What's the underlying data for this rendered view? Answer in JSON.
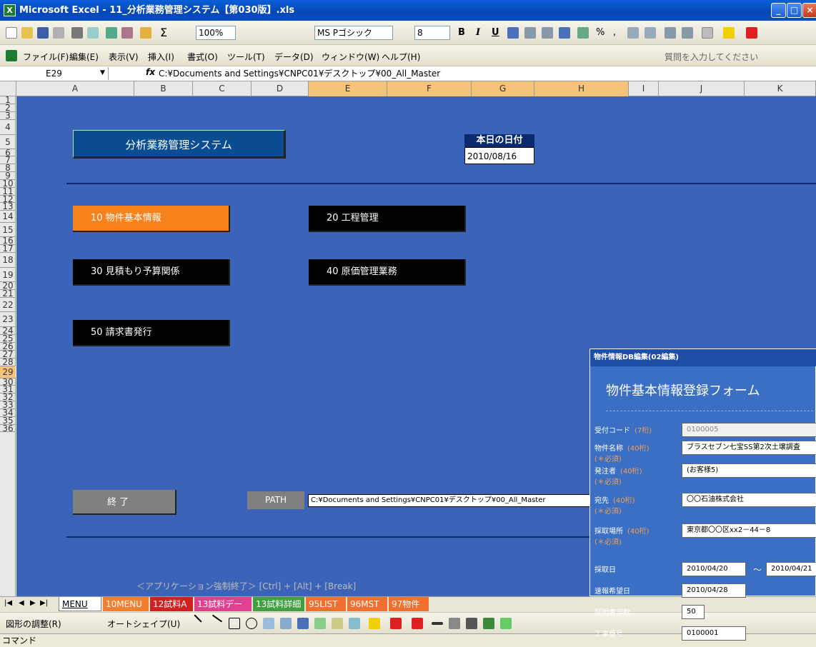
{
  "window": {
    "title": "Microsoft Excel - 11_分析業務管理システム【第030版】.xls",
    "excel_badge": "X"
  },
  "toolbar": {
    "zoom": "100%",
    "font": "MS Pゴシック",
    "size": "8",
    "bold": "B",
    "italic": "I",
    "underline": "U",
    "percent": "%",
    "comma": ","
  },
  "menu": {
    "items": [
      "ファイル(F)",
      "編集(E)",
      "表示(V)",
      "挿入(I)",
      "書式(O)",
      "ツール(T)",
      "データ(D)",
      "ウィンドウ(W)",
      "ヘルプ(H)"
    ],
    "help_placeholder": "質問を入力してください"
  },
  "formula_bar": {
    "cell": "E29",
    "fx": "fx",
    "value": "C:¥Documents and Settings¥CNPC01¥デスクトップ¥00_All_Master"
  },
  "columns": [
    "A",
    "B",
    "C",
    "D",
    "E",
    "F",
    "G",
    "H",
    "I",
    "J",
    "K"
  ],
  "rows": [
    "1",
    "2",
    "3",
    "4",
    "5",
    "6",
    "7",
    "8",
    "9",
    "10",
    "11",
    "12",
    "13",
    "14",
    "15",
    "16",
    "17",
    "18",
    "19",
    "20",
    "21",
    "22",
    "23",
    "24",
    "25",
    "26",
    "27",
    "28",
    "29",
    "30",
    "31",
    "32",
    "33",
    "34",
    "35",
    "36"
  ],
  "sheet": {
    "app_title": "分析業務管理システム",
    "date_label": "本日の日付",
    "date_value": "2010/08/16",
    "buttons": [
      "10 物件基本情報",
      "20 工程管理",
      "30 見積もり予算関係",
      "40 原価管理業務",
      "50 請求書発行"
    ],
    "exit_label": "終 了",
    "path_label": "PATH",
    "path_value": "C:¥Documents and Settings¥CNPC01¥デスクトップ¥00_All_Master",
    "footer_note": "＜アプリケーション強制終了＞ [Ctrl] + [Alt] + [Break]"
  },
  "tabs": [
    "MENU",
    "10MENU",
    "12試料A",
    "13試料データ",
    "13試料詳細",
    "95LIST",
    "96MST",
    "97物件"
  ],
  "tab_colors": [
    "#ffffff",
    "#f08030",
    "#d02020",
    "#e04090",
    "#40a040",
    "#f07030",
    "#f07030",
    "#f07030"
  ],
  "draw_toolbar": {
    "adjust": "図形の調整(R)",
    "autoshape": "オートシェイプ(U)"
  },
  "status": "コマンド",
  "form": {
    "window_title": "物件情報DB編集(02編集)",
    "heading": "物件基本情報登録フォーム",
    "fields": [
      {
        "label": "受付コード",
        "hint": "(7桁)",
        "req": "",
        "value": "0100005"
      },
      {
        "label": "物件名称",
        "hint": "(40桁)",
        "req": "(＊必須)",
        "value": "ブラスセブン七宝SS第2次土壌調査"
      },
      {
        "label": "発注者",
        "hint": "(40桁)",
        "req": "(＊必須)",
        "value": "(お客様5)"
      },
      {
        "label": "宛先",
        "hint": "(40桁)",
        "req": "(＊必須)",
        "value": "〇〇石油株式会社"
      },
      {
        "label": "採取場所",
        "hint": "(40桁)",
        "req": "(＊必須)",
        "value": "東京都〇〇区xx2－44－8"
      },
      {
        "label": "採取日",
        "hint": "",
        "req": "",
        "value": "2010/04/20",
        "value2": "2010/04/21",
        "sep": "～"
      },
      {
        "label": "速報希望日",
        "hint": "",
        "req": "",
        "value": "2010/04/28"
      },
      {
        "label": "証明書部数",
        "hint": "",
        "req": "",
        "value": "50"
      },
      {
        "label": "工事番号",
        "hint": "",
        "req": "",
        "value": "0100001"
      }
    ]
  }
}
